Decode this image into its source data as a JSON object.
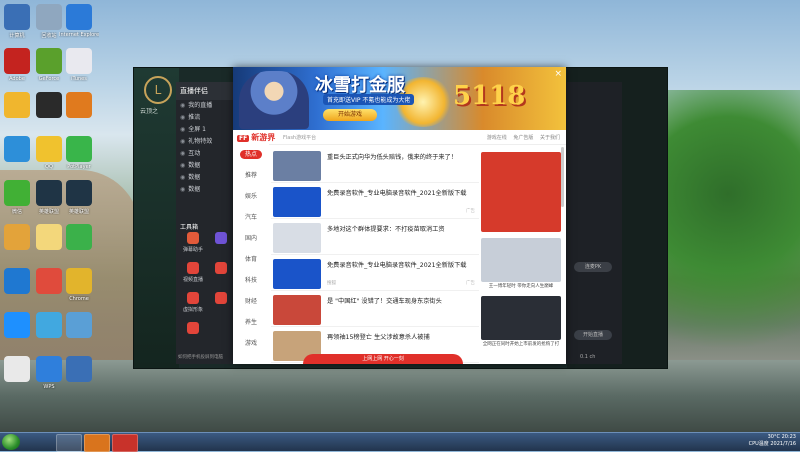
{
  "desktop": {
    "icons": [
      {
        "label": "计算机",
        "color": "#3a6fb5"
      },
      {
        "label": "回收站",
        "color": "#8fa7bf"
      },
      {
        "label": "Internet Explorer",
        "color": "#2b7ad8"
      },
      {
        "label": "Adobe",
        "color": "#c4231f"
      },
      {
        "label": "GeForce",
        "color": "#5aa02c"
      },
      {
        "label": "iTunes",
        "color": "#e9e9ef"
      },
      {
        "label": "",
        "color": "#f0b62e"
      },
      {
        "label": "",
        "color": "#2a2a2a"
      },
      {
        "label": "",
        "color": "#e07a1e"
      },
      {
        "label": "",
        "color": "#2d8fd9"
      },
      {
        "label": "QQ",
        "color": "#f0c22e"
      },
      {
        "label": "PotPlayer",
        "color": "#39b54a"
      },
      {
        "label": "微信",
        "color": "#41b035"
      },
      {
        "label": "英雄联盟",
        "color": "#1f3445"
      },
      {
        "label": "英雄联盟",
        "color": "#1f3445"
      },
      {
        "label": "",
        "color": "#e3a33a"
      },
      {
        "label": "",
        "color": "#f3d77b"
      },
      {
        "label": "",
        "color": "#3bb14a"
      },
      {
        "label": "",
        "color": "#1f78d1"
      },
      {
        "label": "",
        "color": "#e04b3c"
      },
      {
        "label": "Chrome",
        "color": "#e2b42c"
      },
      {
        "label": "",
        "color": "#1e90ff"
      },
      {
        "label": "",
        "color": "#41a8e0"
      },
      {
        "label": "",
        "color": "#5a9fd6"
      },
      {
        "label": "",
        "color": "#e9e9e9"
      },
      {
        "label": "WPS",
        "color": "#2f7fdc"
      },
      {
        "label": "",
        "color": "#3a6fb5"
      }
    ]
  },
  "taskbar": {
    "tray_temp": "30°C",
    "tray_cpu": "CPU温度",
    "time": "20:23",
    "date": "2021/7/16"
  },
  "launcher": {
    "logo_letter": "L",
    "side_text": "云顶之"
  },
  "client": {
    "title": "直播伴侣",
    "rows": [
      "我的直播",
      "推流",
      "全屏 1",
      "礼物特效",
      "互动",
      "数据",
      "数据",
      "数据"
    ],
    "tools_label": "工具箱",
    "tools": [
      {
        "label": "弹幕助手",
        "color": "#e25a3a"
      },
      {
        "label": "",
        "color": "#6f53d6"
      },
      {
        "label": "视频直播",
        "color": "#e2453a"
      },
      {
        "label": "",
        "color": "#e2453a"
      },
      {
        "label": "虚拟形象",
        "color": "#e2453a"
      },
      {
        "label": "",
        "color": "#e2453a"
      },
      {
        "label": "",
        "color": "#e2453a"
      }
    ],
    "bottom_note": "如何把手机投屏到电脑",
    "right_buttons": [
      "连麦PK",
      "开始直播"
    ],
    "right_footer": "0.1 ch"
  },
  "popup": {
    "banner": {
      "title": "冰雪打金服",
      "subtitle": "首充即送VIP 不氪也能成为大佬",
      "cta": "开始游戏",
      "number": "5118",
      "close": "×"
    },
    "header": {
      "ff": "FF",
      "logo": "新游界",
      "slogan": "Flash游戏平台",
      "links": [
        "游戏在线",
        "免广告版",
        "关于我们"
      ]
    },
    "categories": [
      "热点",
      "推荐",
      "娱乐",
      "汽车",
      "国内",
      "体育",
      "科技",
      "财经",
      "养生",
      "游戏"
    ],
    "active_category": 0,
    "feed": [
      {
        "title": "重巨头正式向华为低头赔钱，俄来的终于来了！",
        "src": "",
        "tag": "",
        "color": "#6b7fa3"
      },
      {
        "title": "免费录音软件_专业电脑录音软件_2021全新版下载",
        "src": "",
        "tag": "广告",
        "color": "#1a54c9"
      },
      {
        "title": "多地对这个群体提要求：不打疫苗取消工资",
        "src": "",
        "tag": "",
        "color": "#d8dde5"
      },
      {
        "title": "免费录音软件_专业电脑录音软件_2021全新版下载",
        "src": "搜狐",
        "tag": "广告",
        "color": "#1a54c9"
      },
      {
        "title": "是 \"中国红\" 没错了！交通车现身东京街头",
        "src": "",
        "tag": "",
        "color": "#c9483a"
      },
      {
        "title": "再领袖15榜登亡 生父涉故意杀人被捕",
        "src": "",
        "tag": "",
        "color": "#c7a37a"
      }
    ],
    "side": [
      {
        "caption": "",
        "color": "#d63a2b"
      },
      {
        "caption": "王一博年轻时 带你走向人生巅峰",
        "color": "#c7ced8"
      },
      {
        "caption": "全网正在同时开始上市前发的抢购了打",
        "color": "#2a2e36"
      }
    ],
    "footer": "上网上网 开心一刻"
  }
}
